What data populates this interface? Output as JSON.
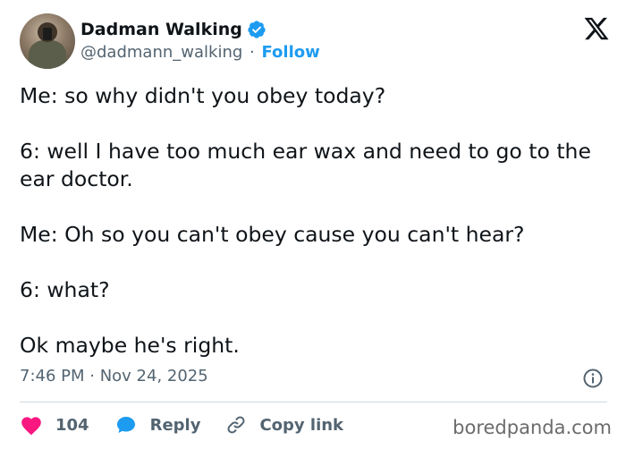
{
  "author": {
    "name": "Dadman Walking",
    "handle": "@dadmann_walking",
    "separator": "·",
    "follow_label": "Follow",
    "verified_icon": "verified-badge-icon"
  },
  "brand": {
    "logo_icon": "x-logo-icon"
  },
  "tweet": {
    "paragraphs": [
      "Me: so why didn't you obey today?",
      "6: well I have too much ear wax and need to go to the ear doctor.",
      "Me: Oh so you can't obey cause you can't hear?",
      "6: what?",
      "Ok maybe he's right."
    ],
    "timestamp": "7:46 PM · Nov 24, 2025"
  },
  "actions": {
    "like_count": "104",
    "reply_label": "Reply",
    "copy_link_label": "Copy link"
  },
  "watermark": "boredpanda.com",
  "colors": {
    "accent": "#1d9bf0",
    "like": "#f91880",
    "text": "#0f1419",
    "muted": "#536471"
  }
}
